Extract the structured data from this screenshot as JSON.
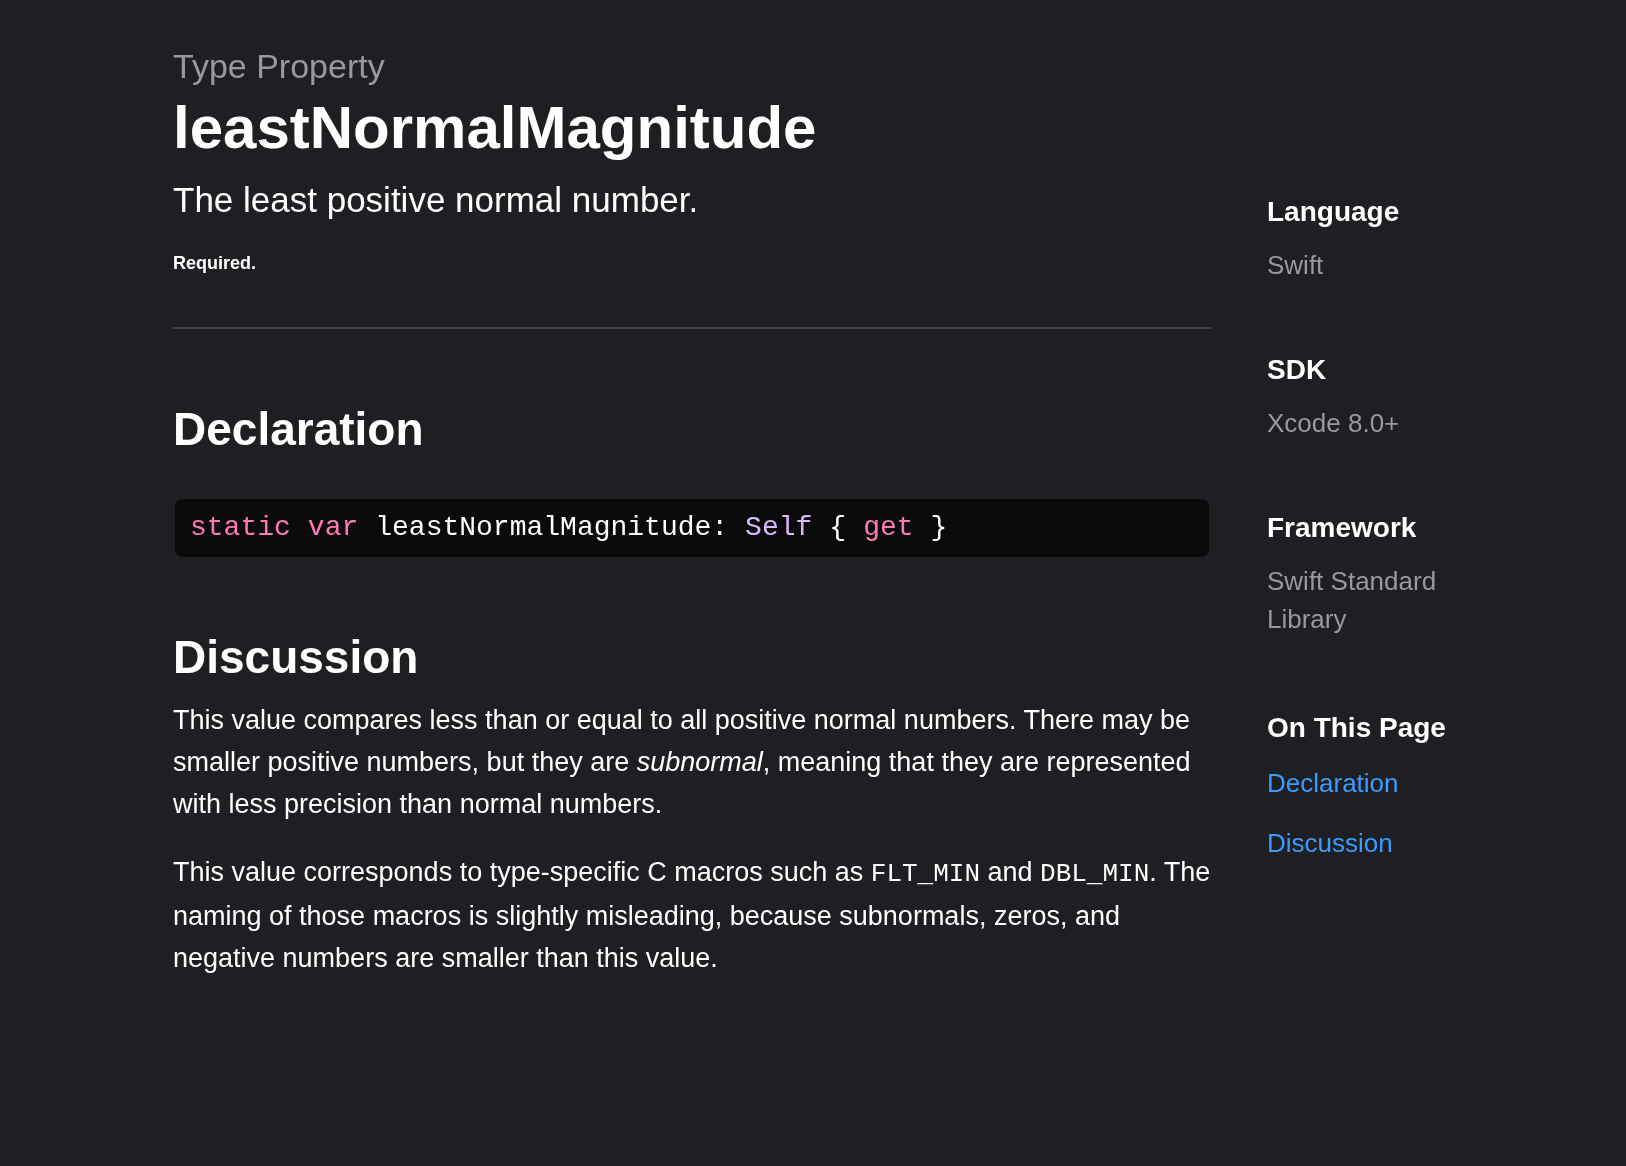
{
  "eyebrow": "Type Property",
  "title": "leastNormalMagnitude",
  "abstract": "The least positive normal number.",
  "required": "Required.",
  "declaration": {
    "heading": "Declaration",
    "tokens": [
      {
        "kind": "keyword",
        "text": "static"
      },
      {
        "kind": "keyword",
        "text": "var"
      },
      {
        "kind": "plain",
        "text": "leastNormalMagnitude:"
      },
      {
        "kind": "type",
        "text": "Self"
      },
      {
        "kind": "plain",
        "text": "{"
      },
      {
        "kind": "keyword",
        "text": "get"
      },
      {
        "kind": "plain",
        "text": "}"
      }
    ]
  },
  "discussion": {
    "heading": "Discussion",
    "paragraphs": [
      [
        {
          "kind": "text",
          "text": "This value compares less than or equal to all positive normal numbers. There may be smaller positive numbers, but they are *subnormal*, meaning that they are represented with less precision than normal numbers."
        }
      ],
      [
        {
          "kind": "text",
          "text": "This value corresponds to type-specific C macros such as "
        },
        {
          "kind": "code",
          "text": "FLT_MIN"
        },
        {
          "kind": "text",
          "text": " and "
        },
        {
          "kind": "code",
          "text": "DBL_MIN"
        },
        {
          "kind": "text",
          "text": ". The naming of those macros is slightly misleading, because subnormals, zeros, and negative numbers are smaller than this value."
        }
      ]
    ]
  },
  "sidebar": [
    {
      "heading": "Language",
      "value": "Swift"
    },
    {
      "heading": "SDK",
      "value": "Xcode 8.0+"
    },
    {
      "heading": "Framework",
      "value": "Swift Standard Library"
    }
  ],
  "on_this_page": {
    "heading": "On This Page",
    "links": [
      "Declaration",
      "Discussion"
    ]
  }
}
